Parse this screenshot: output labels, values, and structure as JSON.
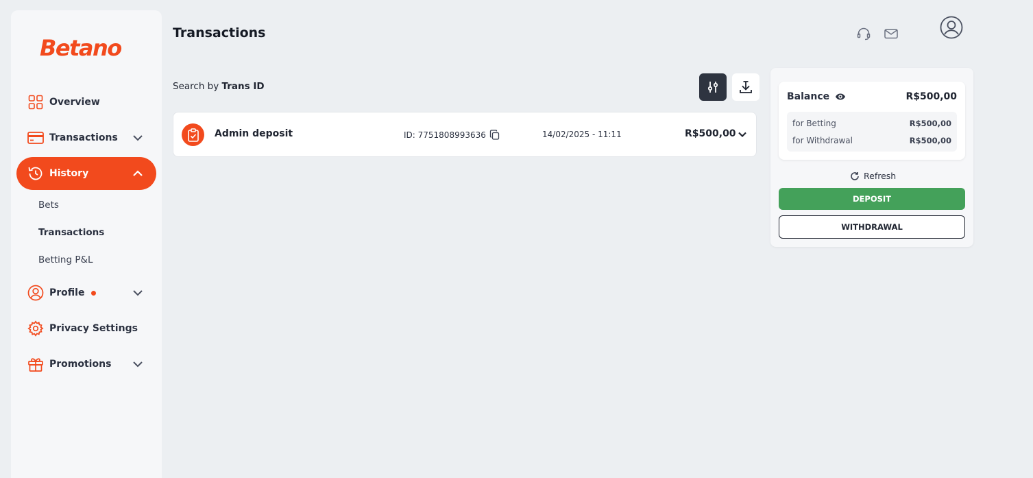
{
  "brand": {
    "logo_text": "Betano",
    "accent": "#f24a1d"
  },
  "sidebar": {
    "items": [
      {
        "label": "Overview",
        "icon": "grid-icon"
      },
      {
        "label": "Transactions",
        "icon": "card-icon",
        "has_chevron": true
      },
      {
        "label": "History",
        "icon": "history-icon",
        "active": true,
        "expanded": true
      },
      {
        "label": "Profile",
        "icon": "user-circle-icon",
        "has_chevron": true,
        "notification_dot": true
      },
      {
        "label": "Privacy Settings",
        "icon": "gear-icon"
      },
      {
        "label": "Promotions",
        "icon": "gift-icon",
        "has_chevron": true
      }
    ],
    "history_subitems": [
      {
        "label": "Bets"
      },
      {
        "label": "Transactions",
        "selected": true
      },
      {
        "label": "Betting P&L"
      }
    ]
  },
  "header": {
    "title": "Transactions",
    "icons": [
      "headset-icon",
      "mail-icon",
      "account-icon"
    ]
  },
  "search": {
    "prefix": "Search by ",
    "field": "Trans ID"
  },
  "transactions": [
    {
      "title": "Admin deposit",
      "id_text": "ID: 7751808993636",
      "date": "14/02/2025 - 11:11",
      "amount": "R$500,00"
    }
  ],
  "balance": {
    "label": "Balance",
    "total": "R$500,00",
    "rows": [
      {
        "label": "for Betting",
        "value": "R$500,00"
      },
      {
        "label": "for Withdrawal",
        "value": "R$500,00"
      }
    ],
    "refresh_label": "Refresh",
    "deposit_label": "DEPOSIT",
    "withdraw_label": "WITHDRAWAL",
    "deposit_color": "#44a15a"
  }
}
